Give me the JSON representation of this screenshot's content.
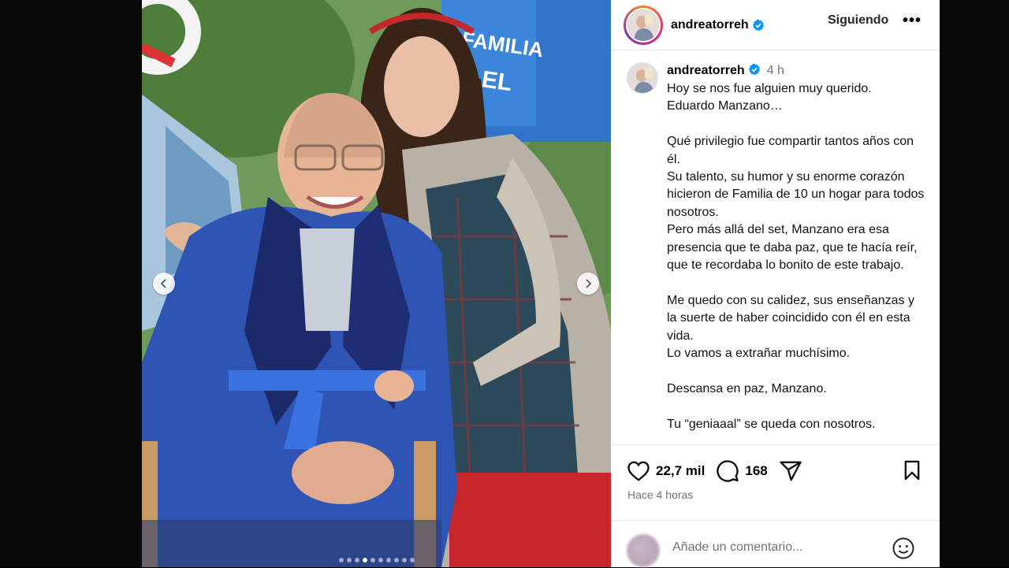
{
  "post": {
    "username": "andreatorreh",
    "follow_label": "Siguiendo",
    "more_label": "•••",
    "caption_time": "4 h",
    "caption_paragraphs": [
      [
        "Hoy se nos fue alguien muy querido.",
        "Eduardo Manzano…"
      ],
      [
        "Qué privilegio fue compartir tantos años con él.",
        "Su talento, su humor y su enorme corazón hicieron de Familia de 10 un hogar para todos nosotros.",
        "Pero más allá del set, Manzano era esa presencia que te daba paz, que te hacía reír, que te recordaba lo bonito de este trabajo."
      ],
      [
        "Me quedo con su calidez, sus enseñanzas y la suerte de haber coincidido con él en esta vida.",
        "Lo vamos a extrañar muchísimo."
      ],
      [
        "Descansa en paz, Manzano."
      ],
      [
        "Tu “geniaaal” se queda con nosotros."
      ]
    ],
    "likes": "22,7 mil",
    "comments": "168",
    "time_ago": "Hace 4 horas",
    "comment_placeholder": "Añade un comentario...",
    "verified_color": "#0095f6"
  },
  "media": {
    "carousel_dots": 10,
    "active_dot": 3,
    "sign_text": [
      "FAMILIA",
      "EL"
    ]
  },
  "icons": [
    "verified-icon",
    "heart-icon",
    "comment-icon",
    "share-icon",
    "bookmark-icon",
    "emoji-icon",
    "chevron-left-icon",
    "chevron-right-icon"
  ]
}
